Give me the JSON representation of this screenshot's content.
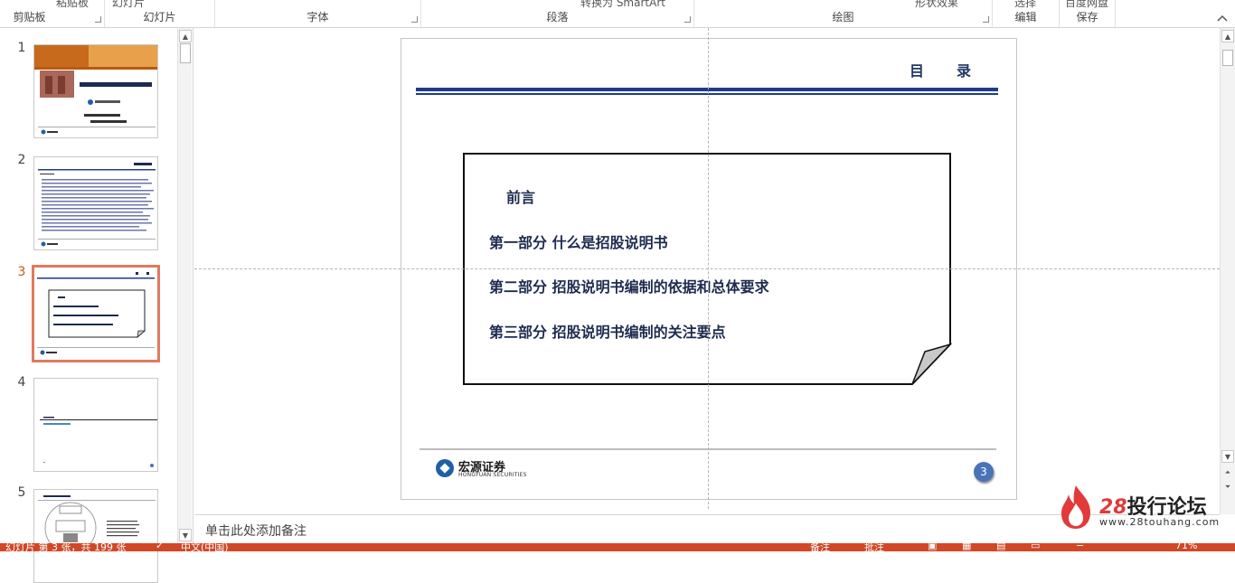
{
  "ribbon": {
    "groups": [
      {
        "label": "剪贴板",
        "cut_text": "粘贴板"
      },
      {
        "label": "幻灯片",
        "cut_text": "幻灯片"
      },
      {
        "label": "字体",
        "cut_text": ""
      },
      {
        "label": "段落",
        "cut_text": "转换为 SmartArt"
      },
      {
        "label": "绘图",
        "cut_text": "形状效果"
      },
      {
        "label": "编辑",
        "cut_text": "选择"
      },
      {
        "label": "保存",
        "cut_text": "百度网盘"
      }
    ],
    "collapse_icon": "chevron-up-icon"
  },
  "thumbnails": {
    "items": [
      {
        "num": "1",
        "selected": false
      },
      {
        "num": "2",
        "selected": false
      },
      {
        "num": "3",
        "selected": true
      },
      {
        "num": "4",
        "selected": false
      },
      {
        "num": "5",
        "selected": false
      }
    ],
    "slide1": {
      "banner": "宏源证券",
      "title": "招股说明书编制要求及关注点",
      "company": "宏源证券股份有限公司"
    },
    "slide2": {
      "heading": "招股说明书"
    },
    "slide3": {
      "heading": "目 录",
      "lines": [
        "前言",
        "第一部分 什么是招股说明书",
        "第二部分 招股说明书编制的依据和总体要求",
        "第三部分 招股说明书编制的关注要点"
      ]
    },
    "slide4": {
      "line": "什么是招股说明书"
    },
    "slide5": {
      "heading": "什么是招股说明书",
      "center": "招股说明书",
      "top": "发行人"
    }
  },
  "slide": {
    "title": "目录",
    "toc": [
      "前言",
      "第一部分  什么是招股说明书",
      "第二部分  招股说明书编制的依据和总体要求",
      "第三部分  招股说明书编制的关注要点"
    ],
    "logo_cn": "宏源证券",
    "logo_en": "HONGYUAN SECURITIES",
    "page_number": "3"
  },
  "notes": {
    "placeholder": "单击此处添加备注"
  },
  "watermark": {
    "num": "28",
    "text": "投行论坛",
    "url": "www.28touhang.com"
  },
  "status": {
    "slide_info": "幻灯片 第 3 张，共 199 张",
    "language": "中文(中国)",
    "notes_btn": "备注",
    "comments_btn": "批注",
    "zoom": "71%"
  },
  "colors": {
    "accent": "#d24726",
    "title_navy": "#1f3c88",
    "selected_border": "#e07a5f"
  }
}
